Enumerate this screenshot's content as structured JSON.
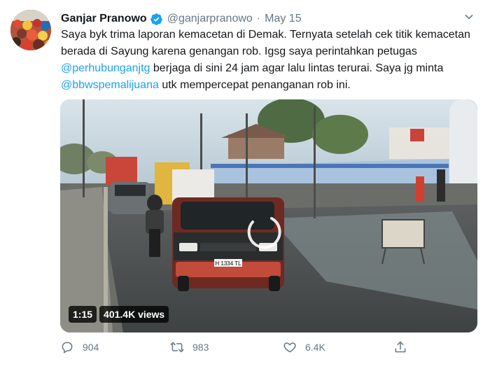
{
  "tweet": {
    "name": "Ganjar Pranowo",
    "handle": "@ganjarpranowo",
    "separator": "·",
    "date": "May 15",
    "text_parts": {
      "p1": "Saya byk trima laporan kemacetan di Demak. Ternyata setelah cek titik kemacetan berada di Sayung karena genangan rob. Igsg saya perintahkan petugas ",
      "m1": "@perhubunganjtg",
      "p2": " berjaga di sini 24 jam agar lalu lintas terurai. Saya jg minta ",
      "m2": "@bbwspemalijuana",
      "p3": " utk mempercepat penanganan rob ini."
    },
    "video": {
      "time": "1:15",
      "views": "401.4K views",
      "plate": "H 1334 TL"
    },
    "actions": {
      "replies": "904",
      "retweets": "983",
      "likes": "6.4K"
    }
  },
  "icons": {
    "verified": "verified-badge-icon",
    "caret": "chevron-down-icon",
    "reply": "reply-icon",
    "retweet": "retweet-icon",
    "like": "heart-icon",
    "share": "share-icon"
  },
  "colors": {
    "accent": "#1da1f2",
    "text": "#14171a",
    "muted": "#657786"
  }
}
